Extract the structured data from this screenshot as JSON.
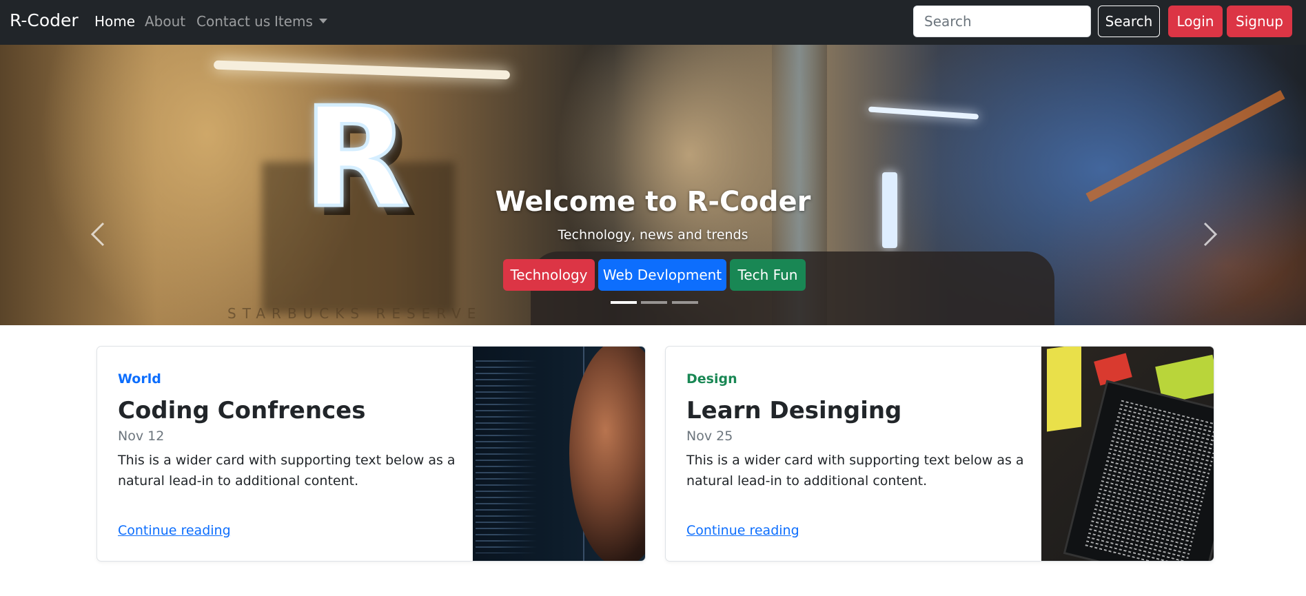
{
  "navbar": {
    "brand": "R-Coder",
    "links": [
      {
        "label": "Home",
        "active": true
      },
      {
        "label": "About",
        "active": false
      },
      {
        "label": "Contact us",
        "active": false
      },
      {
        "label": "Items",
        "active": false,
        "dropdown": true
      }
    ],
    "search": {
      "placeholder": "Search",
      "value": ""
    },
    "search_button": "Search",
    "login_button": "Login",
    "signup_button": "Signup"
  },
  "carousel": {
    "title": "Welcome to R-Coder",
    "subtitle": "Technology, news and trends",
    "buttons": [
      {
        "label": "Technology",
        "color": "#dc3545"
      },
      {
        "label": "Web Devlopment",
        "color": "#0d6efd"
      },
      {
        "label": "Tech Fun",
        "color": "#198754"
      }
    ],
    "indicators": 3,
    "active_slide": 1,
    "prev_icon": "chevron-left-icon",
    "next_icon": "chevron-right-icon"
  },
  "cards": [
    {
      "category": "World",
      "category_color": "#0d6efd",
      "title": "Coding Confrences",
      "date": "Nov 12",
      "text": "This is a wider card with supporting text below as a natural lead-in to additional content.",
      "link": "Continue reading"
    },
    {
      "category": "Design",
      "category_color": "#198754",
      "title": "Learn Desinging",
      "date": "Nov 25",
      "text": "This is a wider card with supporting text below as a natural lead-in to additional content.",
      "link": "Continue reading"
    }
  ],
  "colors": {
    "navbar_bg": "#212529",
    "danger": "#dc3545",
    "primary": "#0d6efd",
    "success": "#198754"
  }
}
